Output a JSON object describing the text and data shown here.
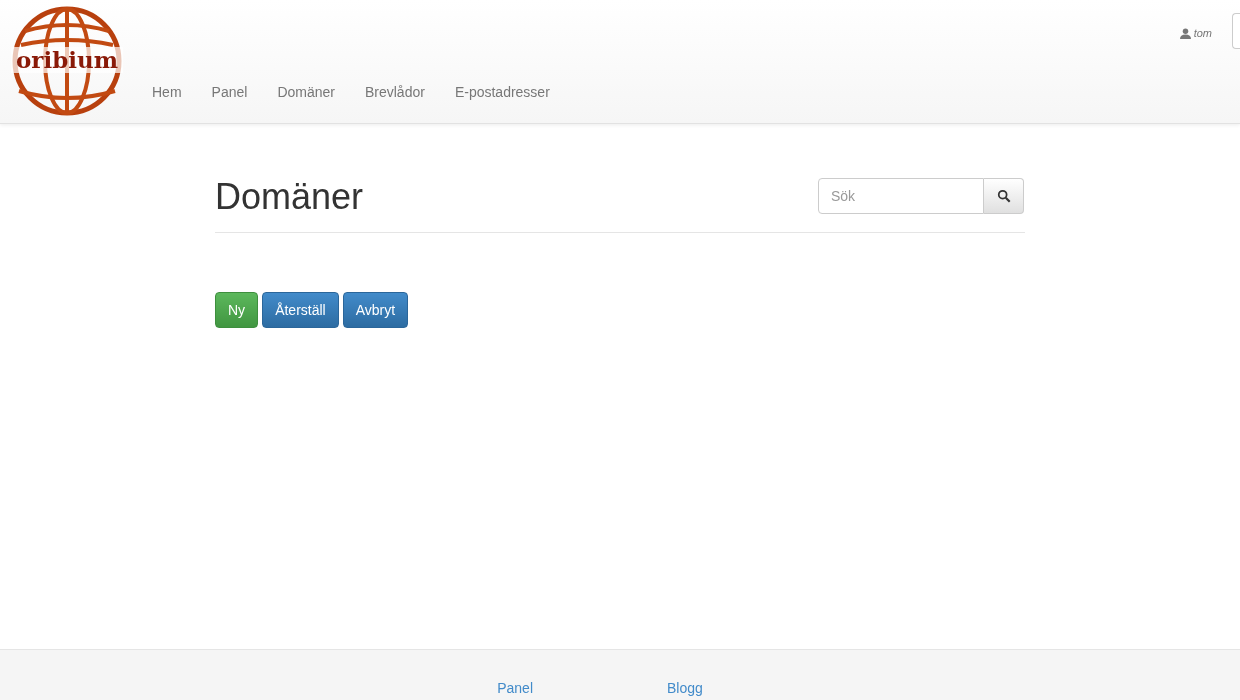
{
  "logo": {
    "text": "oribium"
  },
  "nav": [
    {
      "label": "Hem"
    },
    {
      "label": "Panel"
    },
    {
      "label": "Domäner"
    },
    {
      "label": "Brevlådor"
    },
    {
      "label": "E-postadresser"
    }
  ],
  "user": {
    "name": "tom"
  },
  "page": {
    "title": "Domäner"
  },
  "search": {
    "placeholder": "Sök"
  },
  "actions": [
    {
      "label": "Ny",
      "kind": "success"
    },
    {
      "label": "Återställ",
      "kind": "primary"
    },
    {
      "label": "Avbryt",
      "kind": "primary"
    }
  ],
  "footer": {
    "links": [
      "Panel",
      "Blogg"
    ]
  }
}
